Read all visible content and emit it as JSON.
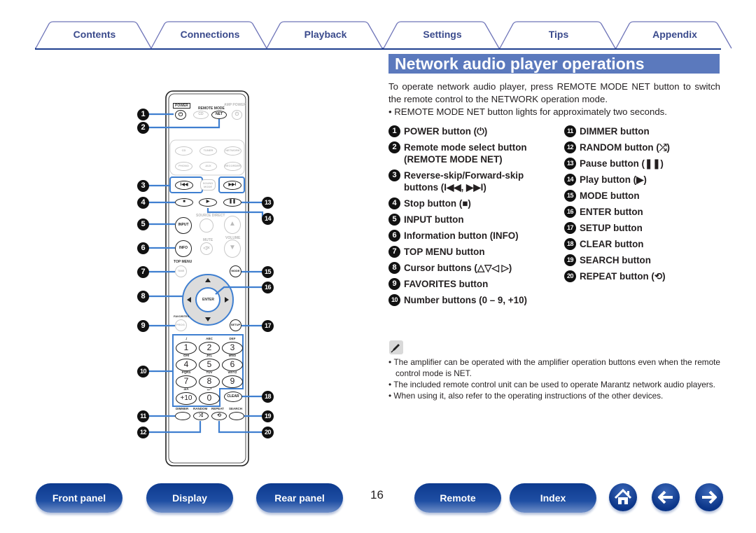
{
  "tabs": [
    {
      "label": "Contents"
    },
    {
      "label": "Connections"
    },
    {
      "label": "Playback"
    },
    {
      "label": "Settings"
    },
    {
      "label": "Tips"
    },
    {
      "label": "Appendix"
    }
  ],
  "colors": {
    "brand_blue": "#1f3f8f",
    "title_bar": "#5b79bd",
    "tab_text": "#3a4a8c",
    "callout_line": "#3f7fd0"
  },
  "section": {
    "title": "Network audio player operations",
    "intro": "To operate network audio player, press REMOTE MODE NET button to switch the remote control to the NETWORK operation mode.",
    "intro_bullet": "• REMOTE MODE NET button lights for approximately two seconds."
  },
  "items_left": [
    {
      "num": "1",
      "text": "POWER button (⏻)"
    },
    {
      "num": "2",
      "text": "Remote mode select button (REMOTE MODE NET)"
    },
    {
      "num": "3",
      "text": "Reverse-skip/Forward-skip buttons (I◀◀, ▶▶I)"
    },
    {
      "num": "4",
      "text": "Stop button (■)"
    },
    {
      "num": "5",
      "text": "INPUT button"
    },
    {
      "num": "6",
      "text": "Information button (INFO)"
    },
    {
      "num": "7",
      "text": "TOP MENU button"
    },
    {
      "num": "8",
      "text": "Cursor buttons (△▽◁ ▷)"
    },
    {
      "num": "9",
      "text": "FAVORITES button"
    },
    {
      "num": "10",
      "text": "Number buttons (0 – 9, +10)"
    }
  ],
  "items_right": [
    {
      "num": "11",
      "text": "DIMMER button"
    },
    {
      "num": "12",
      "text": "RANDOM button (⤮)"
    },
    {
      "num": "13",
      "text": "Pause button (❚❚)"
    },
    {
      "num": "14",
      "text": "Play button (▶)"
    },
    {
      "num": "15",
      "text": "MODE button"
    },
    {
      "num": "16",
      "text": "ENTER button"
    },
    {
      "num": "17",
      "text": "SETUP button"
    },
    {
      "num": "18",
      "text": "CLEAR button"
    },
    {
      "num": "19",
      "text": "SEARCH button"
    },
    {
      "num": "20",
      "text": "REPEAT button (⟲)"
    }
  ],
  "notes": {
    "icon": "pencil-icon",
    "items": [
      "• The amplifier can be operated with the amplifier operation buttons even when the remote control mode is NET.",
      "• The included remote control unit can be used to operate Marantz network audio players.",
      "• When using it, also refer to the operating instructions of the other devices."
    ]
  },
  "remote": {
    "labels": {
      "power": "POWER",
      "remote_mode": "REMOTE MODE",
      "amp_power": "AMP POWER",
      "cd": "CD",
      "net": "NET",
      "source_direct": "SOURCE DIRECT",
      "mute": "MUTE",
      "volume": "VOLUME",
      "top_menu": "TOP MENU",
      "time": "TIME",
      "mode": "MODE",
      "enter": "ENTER",
      "favorites": "FAVORITES",
      "program": "PROG.",
      "setup": "SETUP",
      "input": "INPUT",
      "info": "INFO",
      "sound_mode": "SOUND MODE",
      "clear": "CLEAR",
      "dimmer": "DIMMER",
      "random": "RANDOM",
      "repeat": "REPEAT",
      "search": "SEARCH"
    },
    "source_buttons": [
      "CD",
      "TUNER",
      "NETWORK",
      "PHONO",
      "AUX",
      "RECORDER"
    ],
    "keypad": [
      {
        "key": "1",
        "sub": "./"
      },
      {
        "key": "2",
        "sub": "ABC"
      },
      {
        "key": "3",
        "sub": "DEF"
      },
      {
        "key": "4",
        "sub": "GHI"
      },
      {
        "key": "5",
        "sub": "JKL"
      },
      {
        "key": "6",
        "sub": "MNO"
      },
      {
        "key": "7",
        "sub": "PQRS"
      },
      {
        "key": "8",
        "sub": "TUV"
      },
      {
        "key": "9",
        "sub": "WXYZ"
      },
      {
        "key": "+10",
        "sub": "a/A"
      },
      {
        "key": "0",
        "sub": "⌴.*"
      }
    ],
    "callouts": [
      "1",
      "2",
      "3",
      "4",
      "5",
      "6",
      "7",
      "8",
      "9",
      "10",
      "11",
      "12",
      "13",
      "14",
      "15",
      "16",
      "17",
      "18",
      "19",
      "20"
    ]
  },
  "bottom_nav": {
    "buttons": [
      "Front panel",
      "Display",
      "Rear panel",
      "Remote",
      "Index"
    ],
    "page_number": "16",
    "icons": [
      "home-icon",
      "back-arrow-icon",
      "forward-arrow-icon"
    ]
  }
}
